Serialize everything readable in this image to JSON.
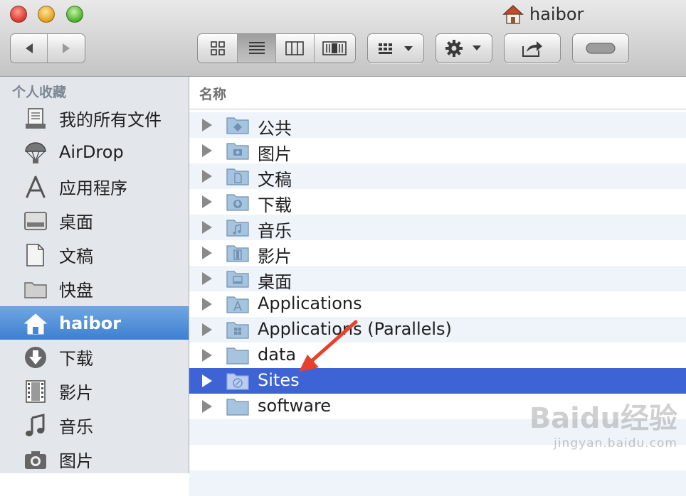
{
  "window": {
    "title": "haibor"
  },
  "toolbar": {
    "nav": [
      "back-arrow",
      "forward-arrow"
    ],
    "view_modes": [
      "icon-view",
      "list-view",
      "column-view",
      "coverflow-view"
    ],
    "active_view": "list-view",
    "arrange": "arrange-menu",
    "action": "gear-menu",
    "share": "share",
    "toggle": "toolbar-toggle"
  },
  "sidebar": {
    "header": "个人收藏",
    "items": [
      {
        "label": "我的所有文件",
        "icon": "all-files-icon"
      },
      {
        "label": "AirDrop",
        "icon": "airdrop-icon"
      },
      {
        "label": "应用程序",
        "icon": "applications-icon"
      },
      {
        "label": "桌面",
        "icon": "desktop-icon"
      },
      {
        "label": "文稿",
        "icon": "documents-icon"
      },
      {
        "label": "快盘",
        "icon": "folder-icon"
      },
      {
        "label": "haibor",
        "icon": "home-icon",
        "selected": true
      },
      {
        "label": "下载",
        "icon": "downloads-icon"
      },
      {
        "label": "影片",
        "icon": "movies-icon"
      },
      {
        "label": "音乐",
        "icon": "music-icon"
      },
      {
        "label": "图片",
        "icon": "camera-icon"
      }
    ]
  },
  "list": {
    "column_header": "名称",
    "rows": [
      {
        "name": "公共"
      },
      {
        "name": "图片"
      },
      {
        "name": "文稿"
      },
      {
        "name": "下载"
      },
      {
        "name": "音乐"
      },
      {
        "name": "影片"
      },
      {
        "name": "桌面"
      },
      {
        "name": "Applications"
      },
      {
        "name": "Applications (Parallels)"
      },
      {
        "name": "data"
      },
      {
        "name": "Sites",
        "selected": true
      },
      {
        "name": "software"
      }
    ]
  },
  "colors": {
    "selection": "#3d63d5",
    "sidebar_selection": "#3e7fd0",
    "arrow": "#e8402a"
  },
  "watermark": {
    "brand": "Baidu经验",
    "url": "jingyan.baidu.com"
  }
}
